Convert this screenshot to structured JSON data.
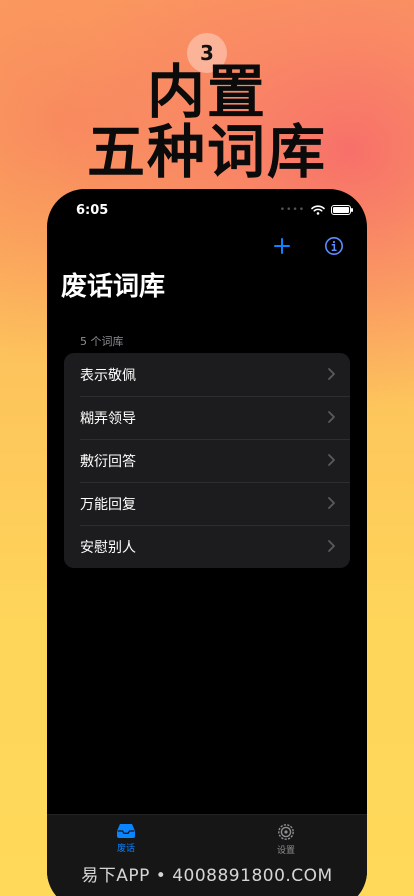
{
  "promo": {
    "step_number": "3",
    "headline_line1": "内置",
    "headline_line2": "五种词库"
  },
  "status_bar": {
    "time": "6:05"
  },
  "nav": {
    "add_icon": "plus-icon",
    "info_icon": "info-icon",
    "accent_color": "#0a84ff"
  },
  "page": {
    "title": "废话词库",
    "section_header": "5 个词库"
  },
  "libraries": [
    {
      "label": "表示敬佩"
    },
    {
      "label": "糊弄领导"
    },
    {
      "label": "敷衍回答"
    },
    {
      "label": "万能回复"
    },
    {
      "label": "安慰别人"
    }
  ],
  "tabbar": {
    "tabs": [
      {
        "label": "废话",
        "icon": "tray-icon",
        "selected": true
      },
      {
        "label": "设置",
        "icon": "gear-icon",
        "selected": false
      }
    ]
  },
  "watermark": "易下APP • 4008891800.COM"
}
